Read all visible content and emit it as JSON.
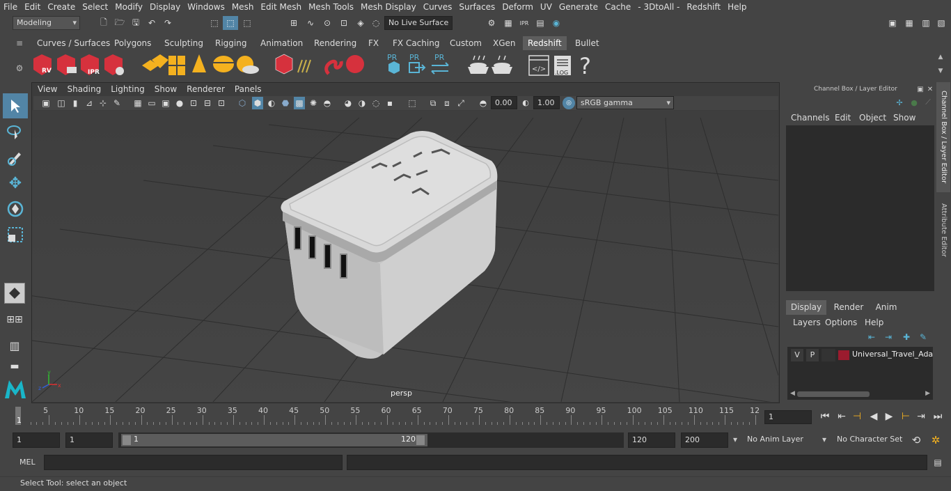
{
  "menubar": [
    "File",
    "Edit",
    "Create",
    "Select",
    "Modify",
    "Display",
    "Windows",
    "Mesh",
    "Edit Mesh",
    "Mesh Tools",
    "Mesh Display",
    "Curves",
    "Surfaces",
    "Deform",
    "UV",
    "Generate",
    "Cache",
    "- 3DtoAll -",
    "Redshift",
    "Help"
  ],
  "statusline": {
    "mode": "Modeling",
    "live_surface": "No Live Surface"
  },
  "shelf_tabs": [
    "Curves / Surfaces",
    "Polygons",
    "Sculpting",
    "Rigging",
    "Animation",
    "Rendering",
    "FX",
    "FX Caching",
    "Custom",
    "XGen",
    "Redshift",
    "Bullet"
  ],
  "active_shelf": "Redshift",
  "shelf_icons": {
    "rv": "RV",
    "ipr": "IPR",
    "pr": "PR",
    "log": ".LOG",
    "help": "?"
  },
  "viewport": {
    "menus": [
      "View",
      "Shading",
      "Lighting",
      "Show",
      "Renderer",
      "Panels"
    ],
    "exposure": "0.00",
    "gamma": "1.00",
    "color_space": "sRGB gamma",
    "camera": "persp",
    "axis": {
      "x": "x",
      "y": "y",
      "z": "z"
    }
  },
  "channel_box": {
    "title": "Channel Box / Layer Editor",
    "menus": [
      "Channels",
      "Edit",
      "Object",
      "Show"
    ],
    "side_tabs": [
      "Channel Box / Layer Editor",
      "Attribute Editor"
    ]
  },
  "layer_editor": {
    "tabs": [
      "Display",
      "Render",
      "Anim"
    ],
    "active_tab": "Display",
    "menus": [
      "Layers",
      "Options",
      "Help"
    ],
    "layer": {
      "v": "V",
      "p": "P",
      "name": "Universal_Travel_Adapter",
      "color": "#9b1b2e"
    }
  },
  "timeline": {
    "ticks": [
      "5",
      "10",
      "15",
      "20",
      "25",
      "30",
      "35",
      "40",
      "45",
      "50",
      "55",
      "60",
      "65",
      "70",
      "75",
      "80",
      "85",
      "90",
      "95",
      "100",
      "105",
      "110",
      "115",
      "12"
    ],
    "start_label": "1",
    "current_frame": "1"
  },
  "range": {
    "start": "1",
    "anim_start": "1",
    "range_start": "1",
    "range_end": "120",
    "end": "120",
    "anim_end": "200",
    "anim_layer": "No Anim Layer",
    "char_set": "No Character Set"
  },
  "command": {
    "label": "MEL"
  },
  "help_line": "Select Tool: select an object",
  "colors": {
    "accent": "#5285a6",
    "red_icon": "#d6313d",
    "yellow_icon": "#f4b11f"
  }
}
